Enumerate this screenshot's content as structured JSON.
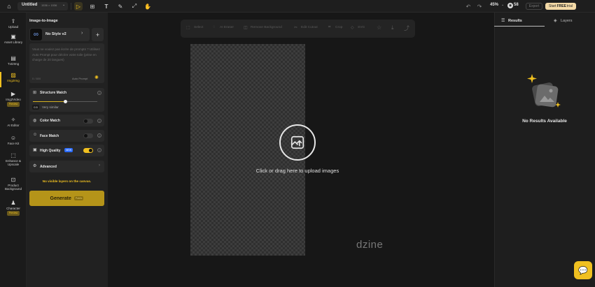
{
  "topbar": {
    "title": "Untitled",
    "size": "1536 × 1536",
    "zoom": "45%",
    "credits": "58",
    "export_label": "Export",
    "trial_prefix": "Start",
    "trial_bold": "FREE",
    "trial_suffix": "trial"
  },
  "nav": {
    "upload": "Upload",
    "asset_library": "Asset Library",
    "txt2img": "Txt2Img",
    "img2img": "Img2Img",
    "img2video": "Img2Video",
    "img2video_badge": "Preview",
    "ai_editor": "AI Editor",
    "face_kit": "Face Kit",
    "enhance": "Enhance & Upscale",
    "product_bg": "Product Background",
    "character": "Character",
    "character_badge": "Preview"
  },
  "panel": {
    "title": "Image-to-Image",
    "style_name": "No Style v2",
    "prompt_placeholder": "Vous ne voulez pas écrire de prompts ? Utilisez Auto Prompt pour décrire votre toile (prise en charge de 20 langues)",
    "prompt_count": "0 / 800",
    "auto_prompt": "Auto Prompt",
    "structure_match": "Structure Match",
    "similarity_value": "0.5",
    "similarity_label": "Very similar",
    "similarity_fraction": 0.5,
    "color_match": "Color Match",
    "color_match_on": false,
    "face_match": "Face Match",
    "face_match_on": false,
    "high_quality": "High Quality",
    "high_quality_badge": "NEW",
    "high_quality_on": true,
    "advanced": "Advanced",
    "layers_warning": "No visible layers on the canvas.",
    "generate": "Generate",
    "generate_badge": "Public"
  },
  "canvas_toolbar": {
    "select": "Select",
    "ai_eraser": "AI Eraser",
    "remove_background": "Remove Background",
    "edit_cutout": "Edit Cutout",
    "crop": "Crop",
    "svg": "SVG"
  },
  "canvas": {
    "upload_hint": "Click or drag here to upload images",
    "watermark": "dzine"
  },
  "right": {
    "tab_results": "Results",
    "tab_layers": "Layers",
    "no_results": "No Results Available"
  },
  "colors": {
    "accent": "#f0c020",
    "background": "#171717"
  }
}
